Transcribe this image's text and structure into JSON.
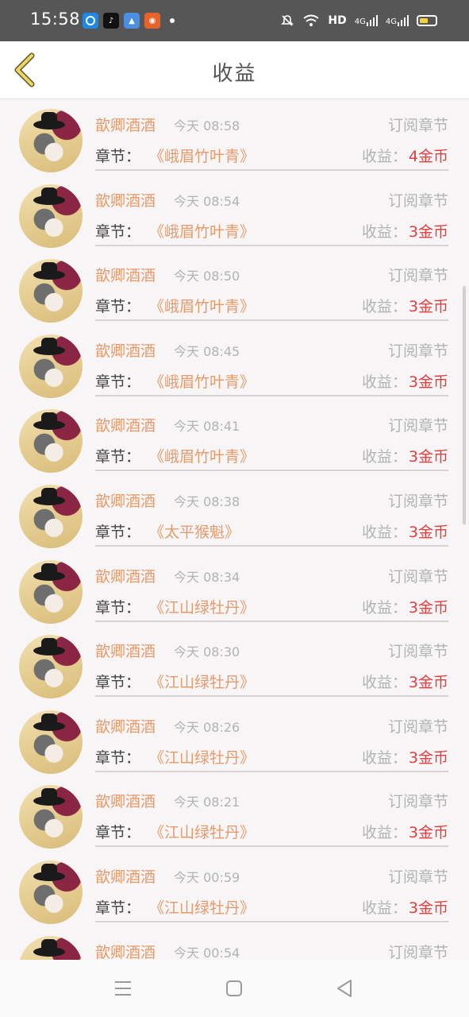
{
  "status_bar": {
    "time": "15:58",
    "network": "HD",
    "signal1": "4G",
    "signal2": "4G",
    "battery_level": 0.4,
    "battery_color": "#f7d23f"
  },
  "header": {
    "title": "收益",
    "back_icon": "chevron-left-icon"
  },
  "list": {
    "chapter_label": "章节：",
    "earn_label": "收益：",
    "items": [
      {
        "name": "歆卿酒酒",
        "time": "今天 08:58",
        "type": "订阅章节",
        "chapter": "《峨眉竹叶青》",
        "earning": "4金币"
      },
      {
        "name": "歆卿酒酒",
        "time": "今天 08:54",
        "type": "订阅章节",
        "chapter": "《峨眉竹叶青》",
        "earning": "3金币"
      },
      {
        "name": "歆卿酒酒",
        "time": "今天 08:50",
        "type": "订阅章节",
        "chapter": "《峨眉竹叶青》",
        "earning": "3金币"
      },
      {
        "name": "歆卿酒酒",
        "time": "今天 08:45",
        "type": "订阅章节",
        "chapter": "《峨眉竹叶青》",
        "earning": "3金币"
      },
      {
        "name": "歆卿酒酒",
        "time": "今天 08:41",
        "type": "订阅章节",
        "chapter": "《峨眉竹叶青》",
        "earning": "3金币"
      },
      {
        "name": "歆卿酒酒",
        "time": "今天 08:38",
        "type": "订阅章节",
        "chapter": "《太平猴魁》",
        "earning": "3金币"
      },
      {
        "name": "歆卿酒酒",
        "time": "今天 08:34",
        "type": "订阅章节",
        "chapter": "《江山绿牡丹》",
        "earning": "3金币"
      },
      {
        "name": "歆卿酒酒",
        "time": "今天 08:30",
        "type": "订阅章节",
        "chapter": "《江山绿牡丹》",
        "earning": "3金币"
      },
      {
        "name": "歆卿酒酒",
        "time": "今天 08:26",
        "type": "订阅章节",
        "chapter": "《江山绿牡丹》",
        "earning": "3金币"
      },
      {
        "name": "歆卿酒酒",
        "time": "今天 08:21",
        "type": "订阅章节",
        "chapter": "《江山绿牡丹》",
        "earning": "3金币"
      },
      {
        "name": "歆卿酒酒",
        "time": "今天 00:59",
        "type": "订阅章节",
        "chapter": "《江山绿牡丹》",
        "earning": "3金币"
      },
      {
        "name": "歆卿酒酒",
        "time": "今天 00:54",
        "type": "订阅章节",
        "chapter": "",
        "earning": ""
      }
    ]
  },
  "colors": {
    "accent": "#e69a6a",
    "earning": "#e04040",
    "muted": "#b3b3b3"
  }
}
